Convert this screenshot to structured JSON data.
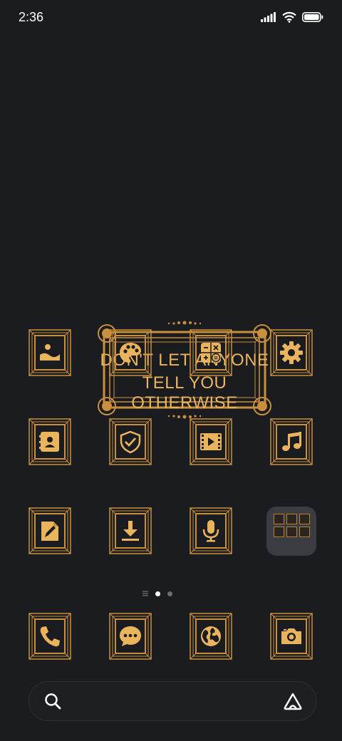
{
  "status_bar": {
    "time": "2:36"
  },
  "widget": {
    "line1": "DON'T LET ANYONE",
    "line2": "TELL YOU OTHERWISE"
  },
  "apps": [
    {
      "icon": "gallery-icon"
    },
    {
      "icon": "themes-icon"
    },
    {
      "icon": "calculator-icon"
    },
    {
      "icon": "settings-icon"
    },
    {
      "icon": "contacts-icon"
    },
    {
      "icon": "security-icon"
    },
    {
      "icon": "video-player-icon"
    },
    {
      "icon": "music-icon"
    },
    {
      "icon": "notes-icon"
    },
    {
      "icon": "downloads-icon"
    },
    {
      "icon": "recorder-icon"
    },
    {
      "icon": "folder"
    }
  ],
  "dock": [
    {
      "icon": "phone-icon"
    },
    {
      "icon": "messages-icon"
    },
    {
      "icon": "browser-icon"
    },
    {
      "icon": "camera-icon"
    }
  ],
  "pages": {
    "count": 2,
    "current": 1
  },
  "search_bar": {},
  "colors": {
    "background": "#1a1c20",
    "gold": "#e9b45c",
    "gold_dark": "#b7822e"
  }
}
